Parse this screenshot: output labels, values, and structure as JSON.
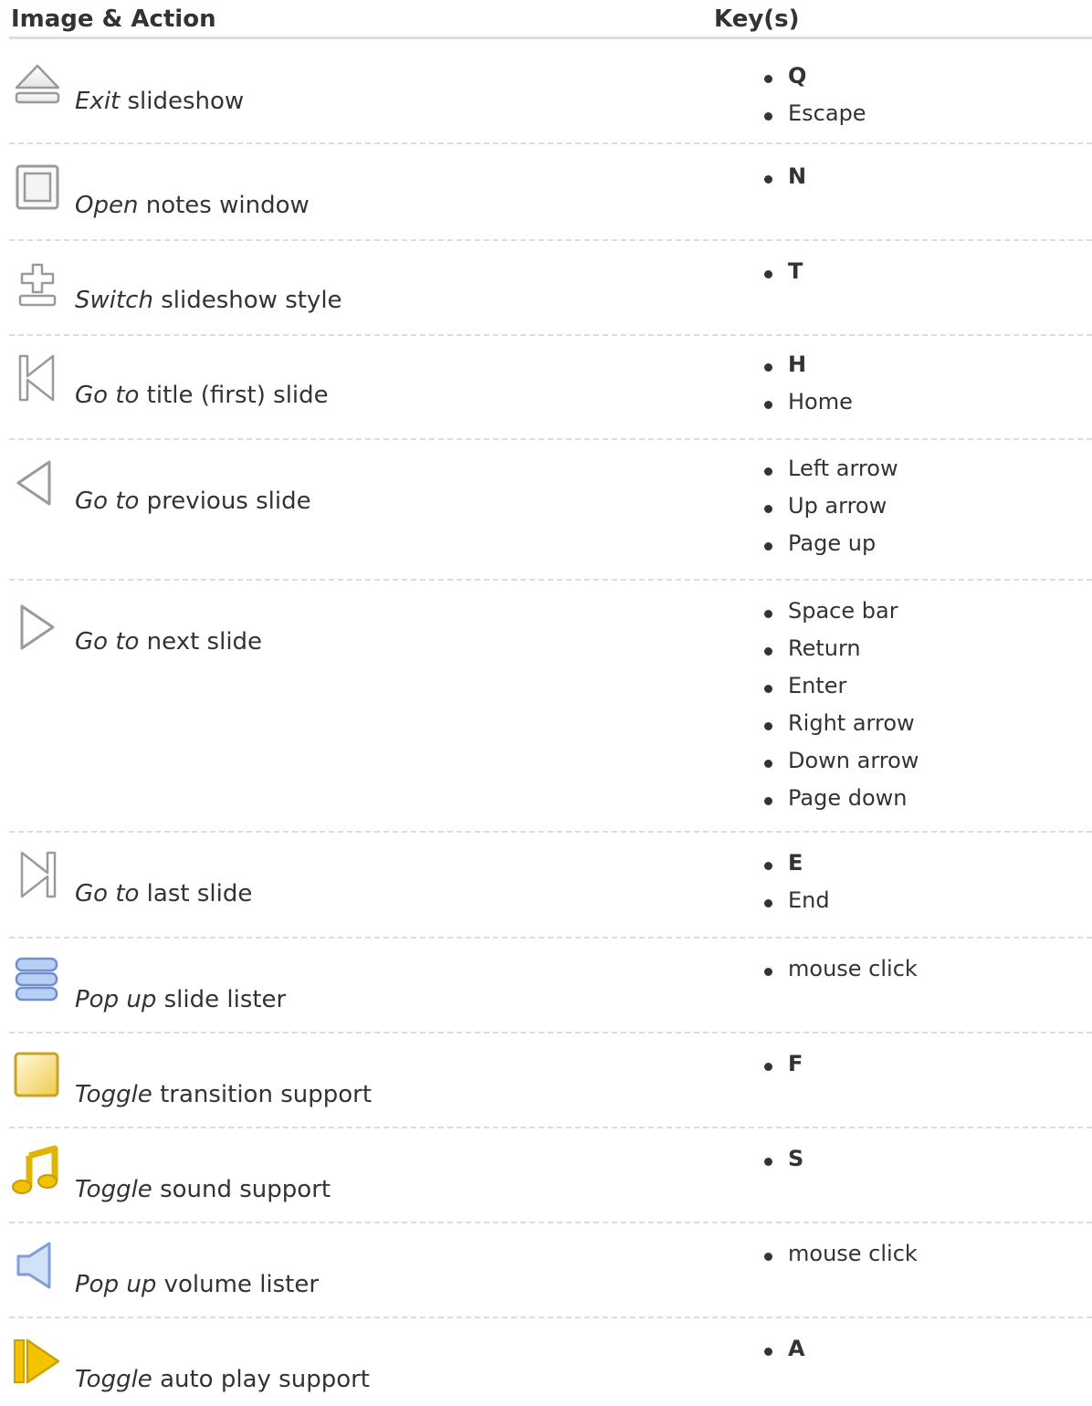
{
  "header": {
    "col1": "Image & Action",
    "col2": "Key(s)"
  },
  "rows": [
    {
      "icon": "eject-icon",
      "verb": "Exit",
      "rest": " slideshow",
      "keys": [
        {
          "label": "Q",
          "bold": true
        },
        {
          "label": "Escape",
          "bold": false
        }
      ]
    },
    {
      "icon": "window-icon",
      "verb": "Open",
      "rest": " notes window",
      "keys": [
        {
          "label": "N",
          "bold": true
        }
      ]
    },
    {
      "icon": "style-switch-icon",
      "verb": "Switch",
      "rest": " slideshow style",
      "keys": [
        {
          "label": "T",
          "bold": true
        }
      ]
    },
    {
      "icon": "first-slide-icon",
      "verb": "Go to",
      "rest": " title (first) slide",
      "keys": [
        {
          "label": "H",
          "bold": true
        },
        {
          "label": "Home",
          "bold": false
        }
      ]
    },
    {
      "icon": "previous-icon",
      "verb": "Go to",
      "rest": " previous slide",
      "keys": [
        {
          "label": "Left arrow",
          "bold": false
        },
        {
          "label": "Up arrow",
          "bold": false
        },
        {
          "label": "Page up",
          "bold": false
        }
      ]
    },
    {
      "icon": "next-icon",
      "verb": "Go to",
      "rest": " next slide",
      "keys": [
        {
          "label": "Space bar",
          "bold": false
        },
        {
          "label": "Return",
          "bold": false
        },
        {
          "label": "Enter",
          "bold": false
        },
        {
          "label": "Right arrow",
          "bold": false
        },
        {
          "label": "Down arrow",
          "bold": false
        },
        {
          "label": "Page down",
          "bold": false
        }
      ]
    },
    {
      "icon": "last-slide-icon",
      "verb": "Go to",
      "rest": " last slide",
      "keys": [
        {
          "label": "E",
          "bold": true
        },
        {
          "label": "End",
          "bold": false
        }
      ]
    },
    {
      "icon": "slide-lister-icon",
      "verb": "Pop up",
      "rest": " slide lister",
      "keys": [
        {
          "label": "mouse click",
          "bold": false
        }
      ]
    },
    {
      "icon": "transition-icon",
      "verb": "Toggle",
      "rest": " transition support",
      "keys": [
        {
          "label": "F",
          "bold": true
        }
      ]
    },
    {
      "icon": "music-note-icon",
      "verb": "Toggle",
      "rest": " sound support",
      "keys": [
        {
          "label": "S",
          "bold": true
        }
      ]
    },
    {
      "icon": "speaker-icon",
      "verb": "Pop up",
      "rest": " volume lister",
      "keys": [
        {
          "label": "mouse click",
          "bold": false
        }
      ]
    },
    {
      "icon": "auto-play-icon",
      "verb": "Toggle",
      "rest": " auto play support",
      "keys": [
        {
          "label": "A",
          "bold": true
        }
      ]
    }
  ]
}
